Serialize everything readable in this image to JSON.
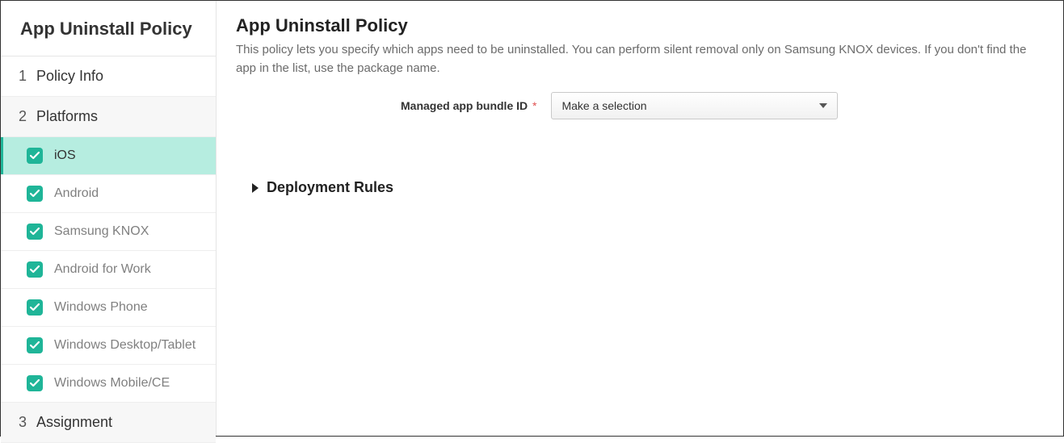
{
  "sidebar": {
    "title": "App Uninstall Policy",
    "steps": {
      "info": {
        "num": "1",
        "label": "Policy Info"
      },
      "platforms": {
        "num": "2",
        "label": "Platforms"
      },
      "assignment": {
        "num": "3",
        "label": "Assignment"
      }
    },
    "platforms": {
      "ios": {
        "label": "iOS"
      },
      "android": {
        "label": "Android"
      },
      "knox": {
        "label": "Samsung KNOX"
      },
      "afw": {
        "label": "Android for Work"
      },
      "winphone": {
        "label": "Windows Phone"
      },
      "windt": {
        "label": "Windows Desktop/Tablet"
      },
      "wince": {
        "label": "Windows Mobile/CE"
      }
    }
  },
  "main": {
    "title": "App Uninstall Policy",
    "description": "This policy lets you specify which apps need to be uninstalled. You can perform silent removal only on Samsung KNOX devices. If you don't find the app in the list, use the package name.",
    "field_label": "Managed app bundle ID",
    "required_mark": "*",
    "select_placeholder": "Make a selection",
    "deploy_section": "Deployment Rules"
  }
}
